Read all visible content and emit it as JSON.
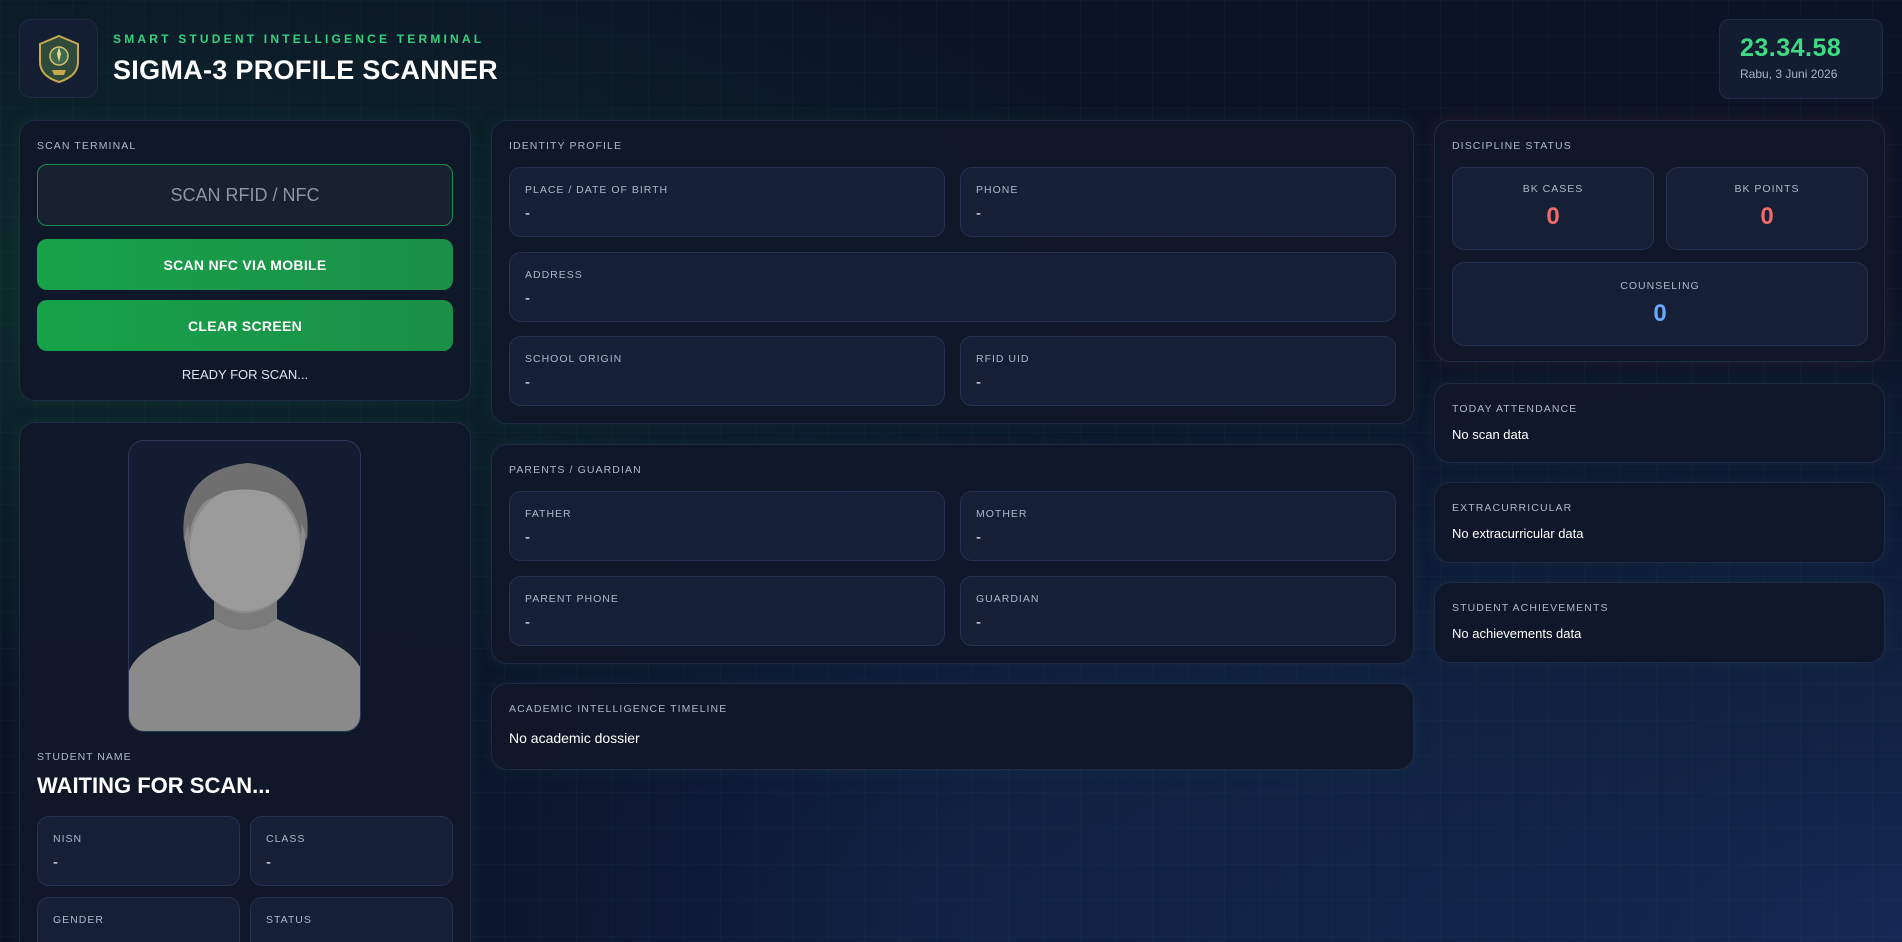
{
  "header": {
    "subtitle": "SMART STUDENT INTELLIGENCE TERMINAL",
    "title": "SIGMA-3 PROFILE SCANNER",
    "clock_time": "23.34.58",
    "clock_date": "Rabu, 3 Juni 2026"
  },
  "scan_terminal": {
    "title": "SCAN TERMINAL",
    "input_placeholder": "SCAN RFID / NFC",
    "scan_nfc_label": "SCAN NFC VIA MOBILE",
    "clear_label": "CLEAR SCREEN",
    "status": "READY FOR SCAN..."
  },
  "student": {
    "name_label": "STUDENT NAME",
    "name": "WAITING FOR SCAN...",
    "fields": [
      {
        "label": "NISN",
        "value": "-"
      },
      {
        "label": "CLASS",
        "value": "-"
      },
      {
        "label": "GENDER",
        "value": ""
      },
      {
        "label": "STATUS",
        "value": ""
      }
    ]
  },
  "identity": {
    "title": "IDENTITY PROFILE",
    "fields": [
      {
        "label": "PLACE / DATE OF BIRTH",
        "value": "-"
      },
      {
        "label": "PHONE",
        "value": "-"
      },
      {
        "label": "ADDRESS",
        "value": "-"
      },
      {
        "label": "SCHOOL ORIGIN",
        "value": "-"
      },
      {
        "label": "RFID UID",
        "value": "-"
      }
    ]
  },
  "parents": {
    "title": "PARENTS / GUARDIAN",
    "fields": [
      {
        "label": "FATHER",
        "value": "-"
      },
      {
        "label": "MOTHER",
        "value": "-"
      },
      {
        "label": "PARENT PHONE",
        "value": "-"
      },
      {
        "label": "GUARDIAN",
        "value": "-"
      }
    ]
  },
  "academic": {
    "title": "ACADEMIC INTELLIGENCE TIMELINE",
    "text": "No academic dossier"
  },
  "discipline": {
    "title": "DISCIPLINE STATUS",
    "bk_cases_label": "BK CASES",
    "bk_cases": "0",
    "bk_points_label": "BK POINTS",
    "bk_points": "0",
    "counseling_label": "COUNSELING",
    "counseling": "0"
  },
  "attendance": {
    "title": "TODAY ATTENDANCE",
    "text": "No scan data"
  },
  "extracurricular": {
    "title": "EXTRACURRICULAR",
    "text": "No extracurricular data"
  },
  "achievements": {
    "title": "STUDENT ACHIEVEMENTS",
    "text": "No achievements data"
  },
  "colors": {
    "accent_green": "#3ddc84",
    "danger_red": "#f06a6a",
    "info_blue": "#6aa8ff",
    "background": "#0b1426"
  }
}
